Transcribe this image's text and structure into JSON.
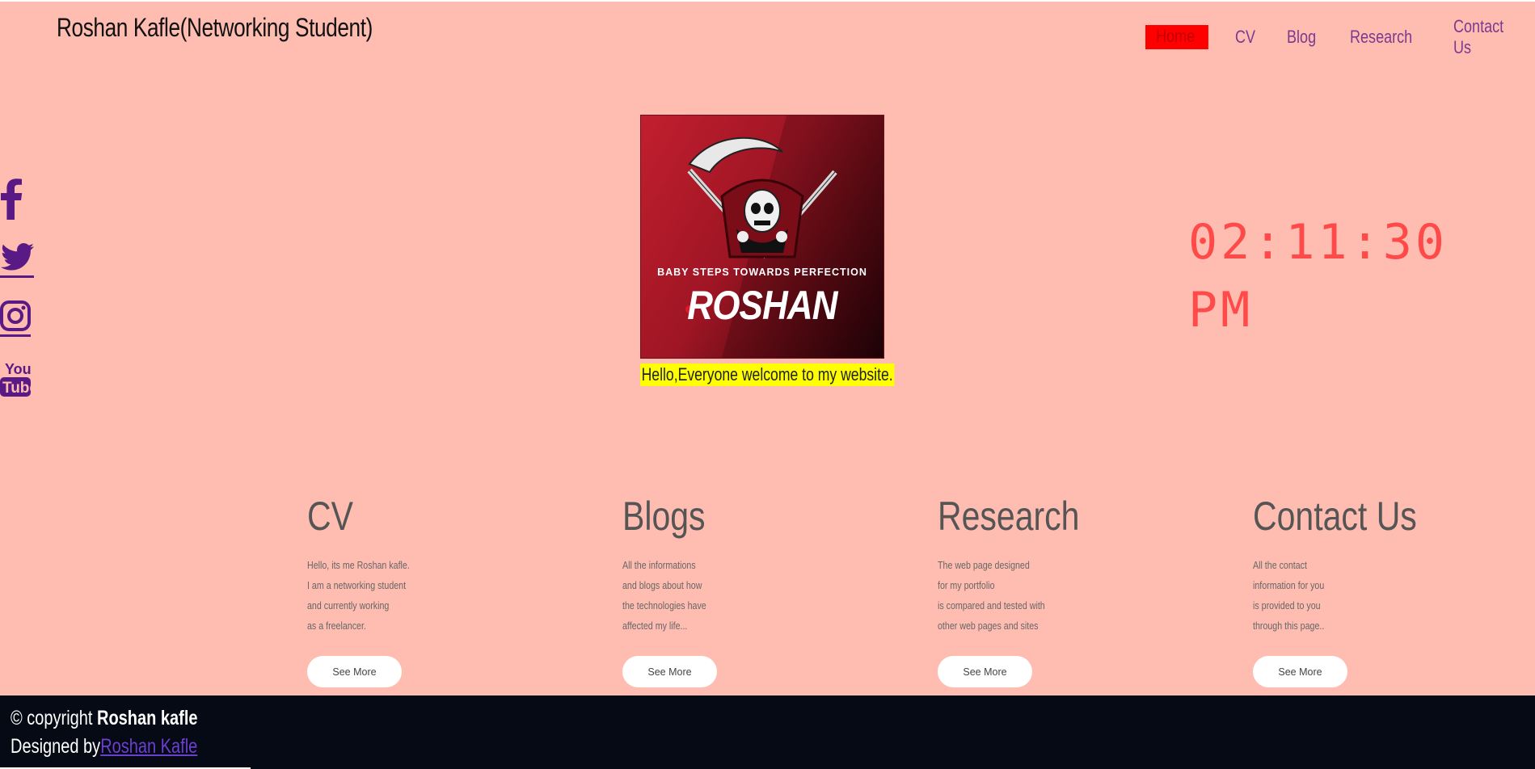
{
  "header": {
    "site_title": "Roshan Kafle(Networking Student)",
    "nav": [
      {
        "label": "Home",
        "active": true
      },
      {
        "label": "CV"
      },
      {
        "label": "Blog"
      },
      {
        "label": "Research"
      },
      {
        "label": "Contact Us"
      }
    ]
  },
  "social": [
    "facebook-icon",
    "twitter-icon",
    "instagram-icon",
    "youtube-icon"
  ],
  "social_icon_color": "#5a1a85",
  "logo": {
    "tagline": "BABY STEPS TOWARDS PERFECTION",
    "name": "ROSHAN"
  },
  "welcome_text": "Hello,Everyone welcome to my website.",
  "clock": {
    "time": "02:11:30",
    "meridiem": "PM"
  },
  "cards": [
    {
      "title": "CV",
      "lines": [
        "Hello, its me Roshan kafle.",
        "I am a networking student",
        "and currently working",
        "as a freelancer."
      ],
      "button": "See More"
    },
    {
      "title": "Blogs",
      "lines": [
        "All the informations",
        "and blogs about how",
        "the technologies have",
        "affected my life..."
      ],
      "button": "See More"
    },
    {
      "title": "Research",
      "lines": [
        "The web page designed",
        "for my portfolio",
        "is compared and tested with",
        "other web pages and sites"
      ],
      "button": "See More"
    },
    {
      "title": "Contact Us",
      "lines": [
        "All the contact",
        "information for you",
        "is provided to you",
        "through this page.."
      ],
      "button": "See More"
    }
  ],
  "footer": {
    "copyright_prefix": "© copyright",
    "copyright_name": "Roshan kafle",
    "designed_prefix": "Designed by",
    "designed_link": "Roshan Kafle"
  },
  "colors": {
    "background": "#ffbdb1",
    "nav_active": "#ff0000",
    "clock": "#ff4a4a",
    "welcome_highlight": "#ffff00",
    "footer": "#060a14"
  }
}
